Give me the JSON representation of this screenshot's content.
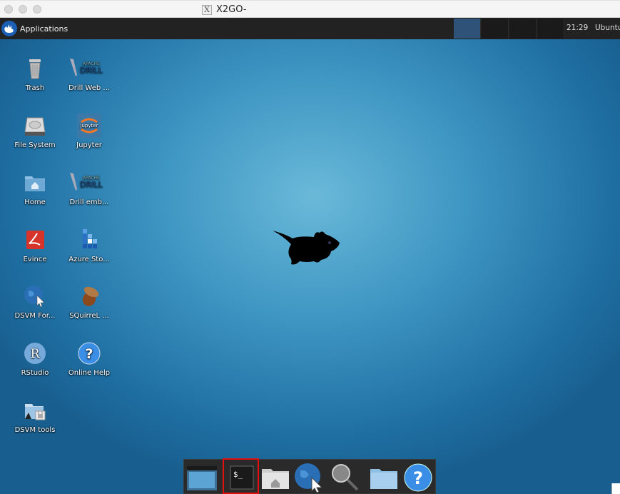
{
  "window": {
    "title": "X2GO-",
    "x_glyph": "X"
  },
  "panel": {
    "applications_label": "Applications",
    "clock": "21:29",
    "user": "Ubuntu",
    "workspaces": [
      {
        "active": true
      },
      {
        "active": false
      },
      {
        "active": false
      },
      {
        "active": false
      }
    ]
  },
  "desktop_icons": [
    {
      "label": "Trash",
      "icon": "trash-icon"
    },
    {
      "label": "Drill Web ...",
      "icon": "apache-drill-icon"
    },
    {
      "label": "File System",
      "icon": "hard-drive-icon"
    },
    {
      "label": "Jupyter",
      "icon": "jupyter-icon"
    },
    {
      "label": "Home",
      "icon": "home-folder-icon"
    },
    {
      "label": "Drill emb...",
      "icon": "apache-drill-icon"
    },
    {
      "label": "Evince",
      "icon": "evince-icon"
    },
    {
      "label": "Azure Sto...",
      "icon": "azure-storage-icon"
    },
    {
      "label": "DSVM For...",
      "icon": "globe-cursor-icon"
    },
    {
      "label": "SQuirreL ...",
      "icon": "acorn-icon"
    },
    {
      "label": "RStudio",
      "icon": "rstudio-icon"
    },
    {
      "label": "Online Help",
      "icon": "help-icon"
    },
    {
      "label": "DSVM tools",
      "icon": "locked-folder-icon"
    }
  ],
  "drill": {
    "apache": "APACHE",
    "drill": "DRILL"
  },
  "jupyter": {
    "text": "jupyter"
  },
  "rstudio": {
    "letter": "R"
  },
  "help": {
    "glyph": "?"
  },
  "dock": {
    "items": [
      {
        "name": "show-desktop"
      },
      {
        "name": "terminal",
        "prompt": "$_",
        "selected": true
      },
      {
        "name": "home-folder"
      },
      {
        "name": "web-browser"
      },
      {
        "name": "app-finder"
      },
      {
        "name": "folder"
      },
      {
        "name": "help",
        "glyph": "?"
      }
    ]
  }
}
